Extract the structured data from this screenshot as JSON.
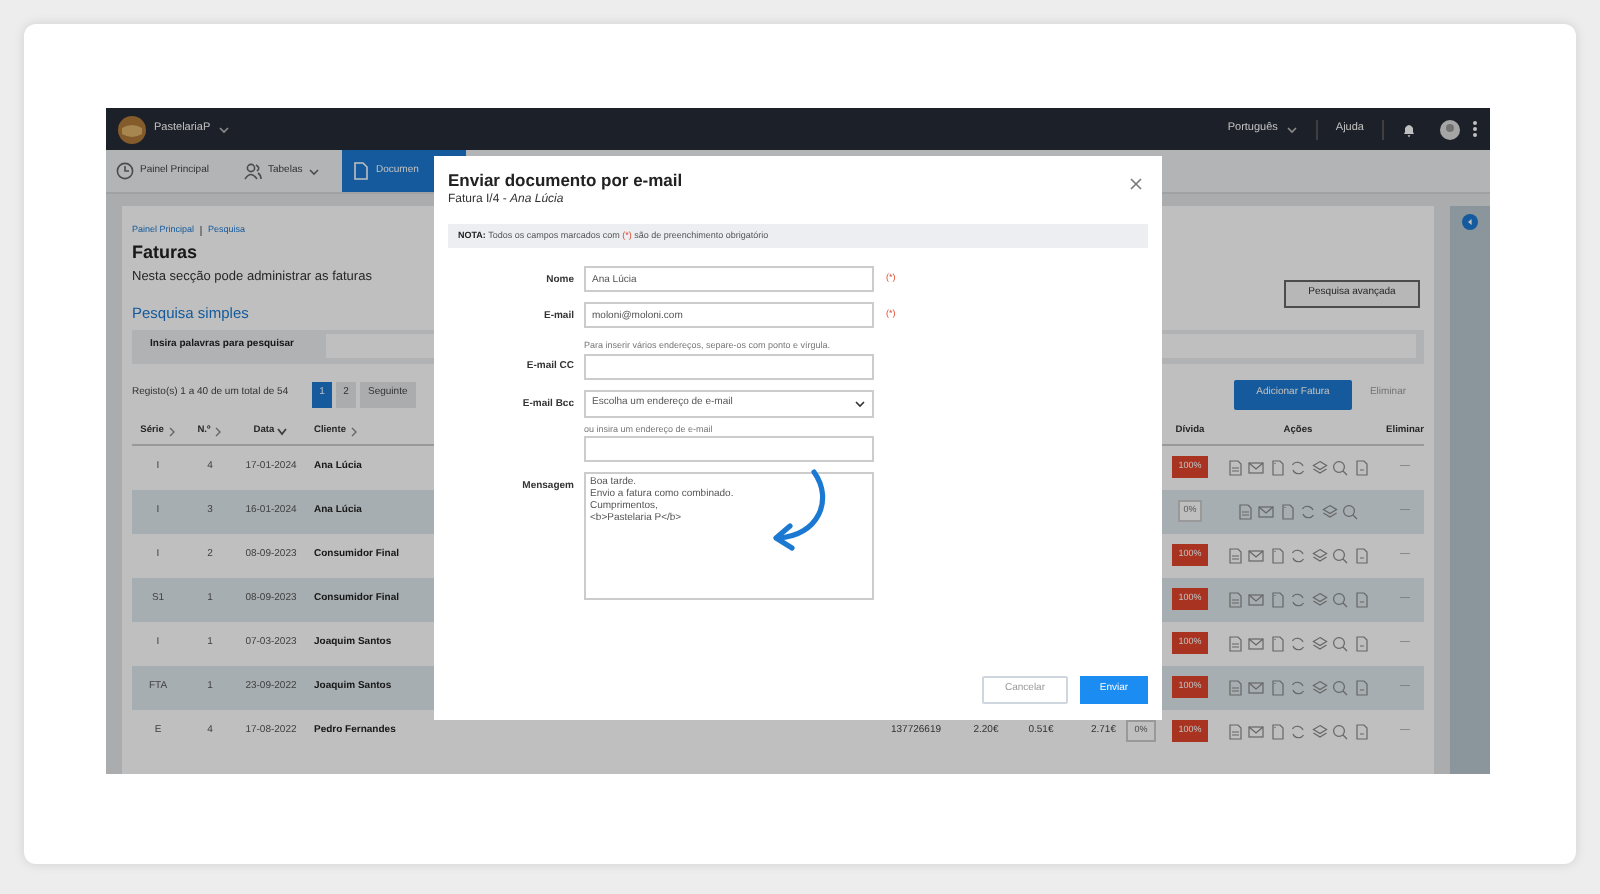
{
  "header": {
    "company": "PastelariaP",
    "language": "Português",
    "help": "Ajuda"
  },
  "tabs": [
    {
      "label": "Painel Principal",
      "dropdown": false,
      "selected": false
    },
    {
      "label": "Tabelas",
      "dropdown": true,
      "selected": false
    },
    {
      "label": "Documen",
      "dropdown": false,
      "selected": true
    }
  ],
  "breadcrumb": [
    "Painel Principal",
    "Pesquisa"
  ],
  "page": {
    "title": "Faturas",
    "subtitle": "Nesta secção pode administrar as faturas"
  },
  "search": {
    "title": "Pesquisa simples",
    "label": "Insira palavras para pesquisar",
    "advanced_button": "Pesquisa avançada"
  },
  "pagination": {
    "summary": "Registo(s) 1 a 40 de um total de 54",
    "pages": [
      {
        "label": "1",
        "selected": true
      },
      {
        "label": "2",
        "selected": false
      }
    ],
    "next": "Seguinte"
  },
  "toolbar": {
    "add_button": "Adicionar Fatura",
    "delete_button": "Eliminar"
  },
  "table": {
    "columns": [
      {
        "label": "Série",
        "sortable": true,
        "sorted": false
      },
      {
        "label": "N.º",
        "sortable": true,
        "sorted": false
      },
      {
        "label": "Data",
        "sortable": true,
        "sorted": true
      },
      {
        "label": "Cliente",
        "sortable": true,
        "sorted": false
      },
      {
        "label": "Dívida"
      },
      {
        "label": "Ações"
      },
      {
        "label": "Eliminar"
      }
    ],
    "rows": [
      {
        "serie": "I",
        "numero": "4",
        "data": "17-01-2024",
        "cliente": "Ana Lúcia",
        "divida": {
          "text": "100%",
          "kind": "due"
        },
        "attachment_action": true,
        "delete": "—"
      },
      {
        "serie": "I",
        "numero": "3",
        "data": "16-01-2024",
        "cliente": "Ana Lúcia",
        "divida": {
          "text": "0%",
          "kind": "paid"
        },
        "attachment_action": false,
        "delete": "—"
      },
      {
        "serie": "I",
        "numero": "2",
        "data": "08-09-2023",
        "cliente": "Consumidor Final",
        "divida": {
          "text": "100%",
          "kind": "due"
        },
        "attachment_action": true,
        "delete": "—"
      },
      {
        "serie": "S1",
        "numero": "1",
        "data": "08-09-2023",
        "cliente": "Consumidor Final",
        "divida": {
          "text": "100%",
          "kind": "due"
        },
        "attachment_action": true,
        "delete": "—"
      },
      {
        "serie": "I",
        "numero": "1",
        "data": "07-03-2023",
        "cliente": "Joaquim Santos",
        "divida": {
          "text": "100%",
          "kind": "due"
        },
        "attachment_action": true,
        "delete": "—"
      },
      {
        "serie": "FTA",
        "numero": "1",
        "data": "23-09-2022",
        "cliente": "Joaquim Santos",
        "divida": {
          "text": "100%",
          "kind": "due"
        },
        "attachment_action": true,
        "delete": "—"
      },
      {
        "serie": "E",
        "numero": "4",
        "data": "17-08-2022",
        "cliente": "Pedro Fernandes",
        "values": [
          "137726619",
          "2.20€",
          "0.51€",
          "2.71€"
        ],
        "discount": "0%",
        "divida": {
          "text": "100%",
          "kind": "due"
        },
        "attachment_action": true,
        "delete": "—"
      }
    ]
  },
  "modal": {
    "title": "Enviar documento por e-mail",
    "subtitle": "Fatura I/4 - ",
    "subtitle_name": "Ana Lúcia",
    "note": {
      "label": "NOTA:",
      "before": "Todos os campos marcados com",
      "mark": "(*)",
      "after": "são de preenchimento obrigatório"
    },
    "fields": [
      {
        "kind": "input",
        "label": "Nome",
        "value": "Ana Lúcia",
        "required_mark": "(*)"
      },
      {
        "kind": "input",
        "label": "E-mail",
        "value": "moloni@moloni.com",
        "required_mark": "(*)"
      },
      {
        "kind": "input",
        "label": "E-mail CC",
        "hint": "Para inserir vários endereços, separe-os com ponto e vírgula."
      },
      {
        "kind": "select",
        "label": "E-mail Bcc",
        "value": "Escolha um endereço de e-mail",
        "hint_after": "ou insira um endereço de e-mail"
      },
      {
        "kind": "textarea",
        "label": "Mensagem",
        "value": "Boa tarde.\nEnvio a fatura como combinado.\nCumprimentos,\n<b>Pastelaria P</b>"
      }
    ],
    "buttons": [
      {
        "label": "Cancelar",
        "primary": false
      },
      {
        "label": "Enviar",
        "primary": true
      }
    ]
  }
}
